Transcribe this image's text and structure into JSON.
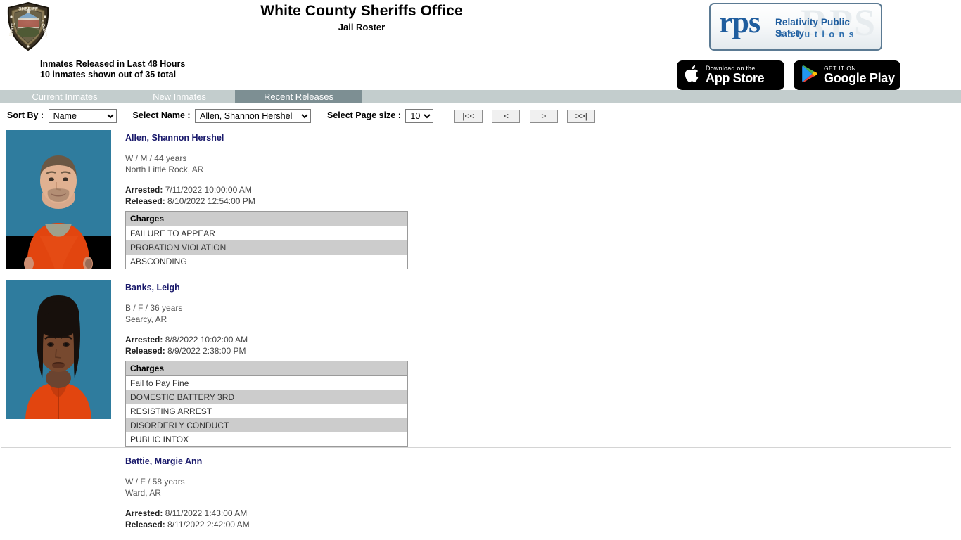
{
  "header": {
    "badge_icon": "sheriff-badge-icon",
    "badge_text_top": "SHERIFF",
    "badge_text_left": "WHITE",
    "badge_text_right": "COUNTY",
    "title": "White County Sheriffs Office",
    "subtitle": "Jail Roster",
    "counts_line1": "Inmates Released in Last 48 Hours",
    "counts_line2": "10 inmates shown out of 35 total",
    "logo": {
      "mark": "rps",
      "ghost": "RPS",
      "tagline": "Relativity Public Safety",
      "solutions": "solutions"
    },
    "app_store": {
      "small": "Download on the",
      "big": "App Store",
      "icon": "apple-icon"
    },
    "google_play": {
      "small": "GET IT ON",
      "big": "Google Play",
      "icon": "google-play-icon"
    }
  },
  "tabs": [
    {
      "label": "Current Inmates",
      "active": false
    },
    {
      "label": "New Inmates",
      "active": false
    },
    {
      "label": "Recent Releases",
      "active": true
    }
  ],
  "controls": {
    "sort_by_label": "Sort By :",
    "sort_by_value": "Name",
    "sort_by_options": [
      "Name"
    ],
    "select_name_label": "Select Name :",
    "select_name_value": "Allen, Shannon Hershel",
    "select_name_options": [
      "Allen, Shannon Hershel"
    ],
    "page_size_label": "Select Page size :",
    "page_size_value": "10",
    "page_size_options": [
      "10"
    ],
    "pagination": {
      "first": "|<<",
      "prev": "<",
      "next": ">",
      "last": ">>|"
    }
  },
  "colors": {
    "tabbar_bg": "#c3cdcd",
    "active_tab_bg": "#7d8f93",
    "name_link": "#19196b",
    "table_alt_row": "#cccccc",
    "logo_blue": "#1f5d9e",
    "separator": "#d4d4d4"
  },
  "charges_header": "Charges",
  "labels": {
    "arrested": "Arrested:",
    "released": "Released:"
  },
  "records": [
    {
      "name": "Allen, Shannon Hershel",
      "demographics": "W / M / 44 years",
      "city": "North Little Rock, AR",
      "arrested": "7/11/2022 10:00:00 AM",
      "released": "8/10/2022 12:54:00 PM",
      "has_photo": true,
      "photo_alt": "mugshot-allen-shannon-hershel",
      "charges": [
        "FAILURE TO APPEAR",
        "PROBATION VIOLATION",
        "ABSCONDING"
      ]
    },
    {
      "name": "Banks, Leigh",
      "demographics": "B / F / 36 years",
      "city": "Searcy, AR",
      "arrested": "8/8/2022 10:02:00 AM",
      "released": "8/9/2022 2:38:00 PM",
      "has_photo": true,
      "photo_alt": "mugshot-banks-leigh",
      "charges": [
        "Fail to Pay Fine",
        "DOMESTIC BATTERY 3RD",
        "RESISTING ARREST",
        "DISORDERLY CONDUCT",
        "PUBLIC INTOX"
      ]
    },
    {
      "name": "Battie, Margie Ann",
      "demographics": "W / F / 58 years",
      "city": "Ward, AR",
      "arrested": "8/11/2022 1:43:00 AM",
      "released": "8/11/2022 2:42:00 AM",
      "has_photo": false,
      "photo_alt": "mugshot-battie-margie-ann",
      "charges": []
    }
  ]
}
